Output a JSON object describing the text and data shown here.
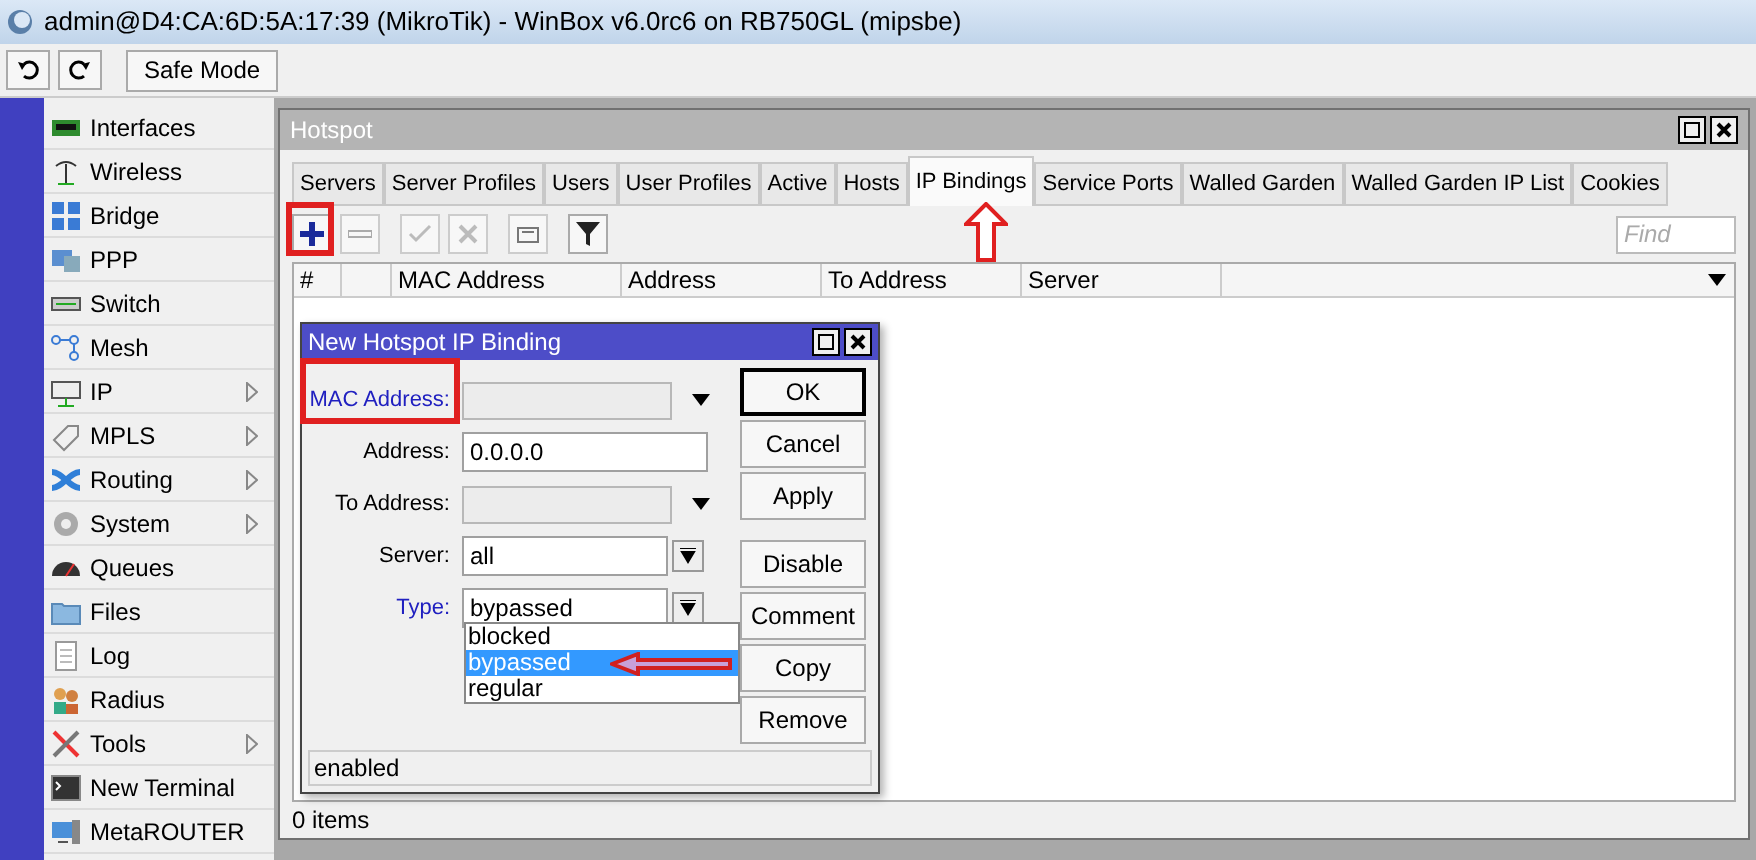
{
  "window": {
    "title": "admin@D4:CA:6D:5A:17:39 (MikroTik) - WinBox v6.0rc6 on RB750GL (mipsbe)"
  },
  "toolbar": {
    "safe_mode": "Safe Mode"
  },
  "sidebar": {
    "items": [
      {
        "label": "Interfaces",
        "submenu": false
      },
      {
        "label": "Wireless",
        "submenu": false
      },
      {
        "label": "Bridge",
        "submenu": false
      },
      {
        "label": "PPP",
        "submenu": false
      },
      {
        "label": "Switch",
        "submenu": false
      },
      {
        "label": "Mesh",
        "submenu": false
      },
      {
        "label": "IP",
        "submenu": true
      },
      {
        "label": "MPLS",
        "submenu": true
      },
      {
        "label": "Routing",
        "submenu": true
      },
      {
        "label": "System",
        "submenu": true
      },
      {
        "label": "Queues",
        "submenu": false
      },
      {
        "label": "Files",
        "submenu": false
      },
      {
        "label": "Log",
        "submenu": false
      },
      {
        "label": "Radius",
        "submenu": false
      },
      {
        "label": "Tools",
        "submenu": true
      },
      {
        "label": "New Terminal",
        "submenu": false
      },
      {
        "label": "MetaROUTER",
        "submenu": false
      }
    ]
  },
  "hotspot": {
    "title": "Hotspot",
    "tabs": [
      {
        "label": "Servers",
        "selected": false
      },
      {
        "label": "Server Profiles",
        "selected": false
      },
      {
        "label": "Users",
        "selected": false
      },
      {
        "label": "User Profiles",
        "selected": false
      },
      {
        "label": "Active",
        "selected": false
      },
      {
        "label": "Hosts",
        "selected": false
      },
      {
        "label": "IP Bindings",
        "selected": true
      },
      {
        "label": "Service Ports",
        "selected": false
      },
      {
        "label": "Walled Garden",
        "selected": false
      },
      {
        "label": "Walled Garden IP List",
        "selected": false
      },
      {
        "label": "Cookies",
        "selected": false
      }
    ],
    "find": {
      "placeholder": "Find"
    },
    "table": {
      "columns": [
        "#",
        "",
        "MAC Address",
        "Address",
        "To Address",
        "Server"
      ]
    },
    "status_bar": "0 items"
  },
  "dialog": {
    "title": "New Hotspot IP Binding",
    "fields": [
      {
        "kind": "combo",
        "label": "MAC Address:",
        "emphasized": true
      },
      {
        "kind": "text",
        "label": "Address:",
        "value": "0.0.0.0",
        "emphasized": false
      },
      {
        "kind": "combo",
        "label": "To Address:",
        "emphasized": false
      },
      {
        "kind": "select",
        "label": "Server:",
        "value": "all",
        "emphasized": false
      },
      {
        "kind": "select",
        "label": "Type:",
        "value": "bypassed",
        "emphasized": true
      }
    ],
    "type_options": [
      {
        "label": "blocked",
        "selected": false
      },
      {
        "label": "bypassed",
        "selected": true
      },
      {
        "label": "regular",
        "selected": false
      }
    ],
    "buttons": [
      {
        "label": "OK",
        "default": true
      },
      {
        "label": "Cancel",
        "default": false
      },
      {
        "label": "Apply",
        "default": false
      },
      {
        "label": "Disable",
        "default": false
      },
      {
        "label": "Comment",
        "default": false
      },
      {
        "label": "Copy",
        "default": false
      },
      {
        "label": "Remove",
        "default": false
      }
    ],
    "status_bar": "enabled"
  }
}
